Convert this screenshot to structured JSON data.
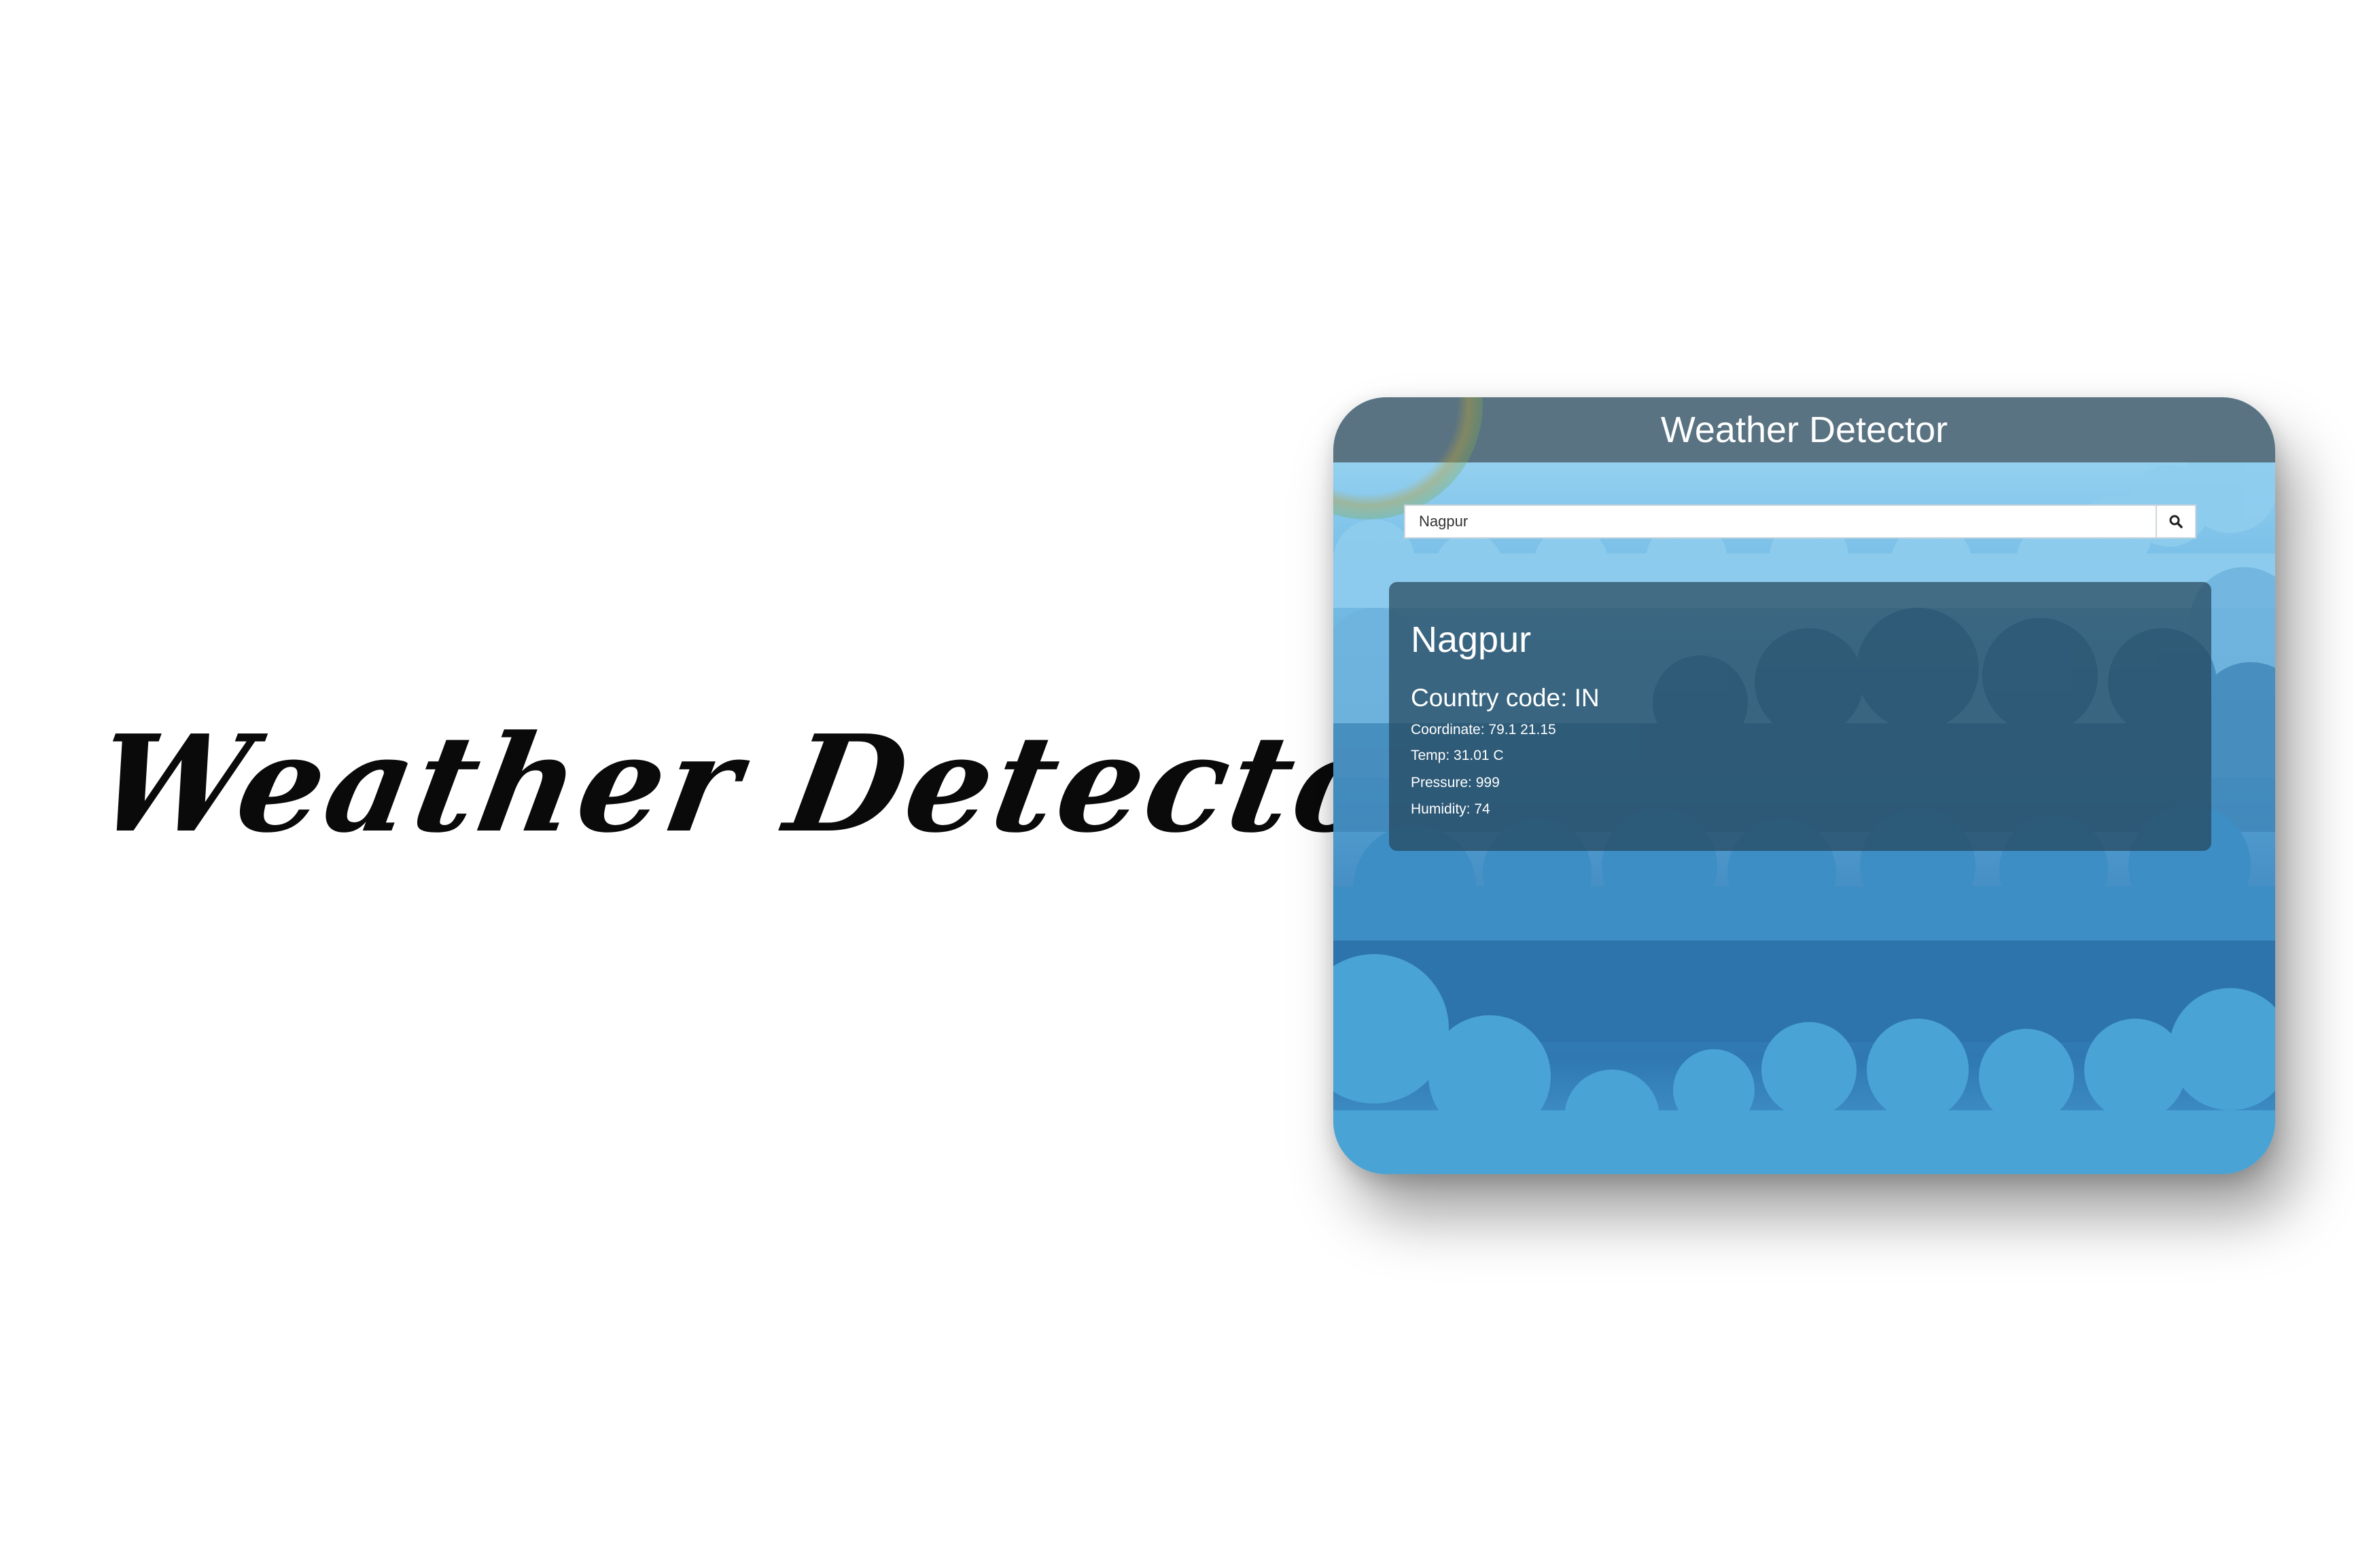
{
  "hero": {
    "title": "Weather Detector"
  },
  "app": {
    "title": "Weather Detector",
    "search": {
      "value": "Nagpur",
      "button_icon": "search-icon"
    },
    "result": {
      "city": "Nagpur",
      "country_label": "Country code:",
      "country_value": "IN",
      "coordinate_label": "Coordinate:",
      "coordinate_value": "79.1 21.15",
      "temp_label": "Temp:",
      "temp_value": "31.01 C",
      "pressure_label": "Pressure:",
      "pressure_value": "999",
      "humidity_label": "Humidity:",
      "humidity_value": "74"
    }
  },
  "colors": {
    "header": "#5a7382",
    "card": "#26465c",
    "sky_top": "#a6dcf5",
    "sky_bottom": "#2f78b2"
  }
}
